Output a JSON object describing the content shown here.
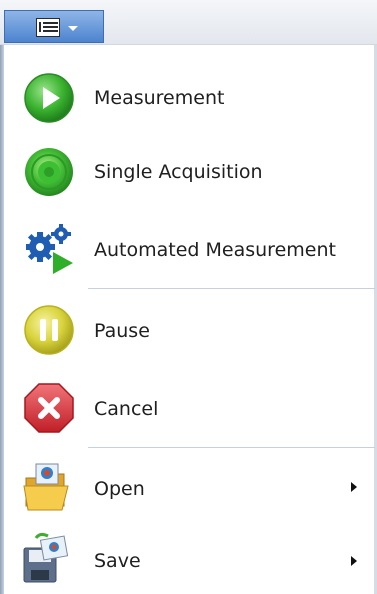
{
  "toolbar": {
    "menu_button_icon": "menu-list-icon",
    "dropdown_icon": "chevron-down-icon"
  },
  "menu": {
    "items": [
      {
        "label": "Measurement",
        "icon": "play-icon",
        "color": "#38b52f"
      },
      {
        "label": "Single Acquisition",
        "icon": "record-icon",
        "color": "#3fb93a"
      },
      {
        "label": "Automated Measurement",
        "icon": "gears-play-icon",
        "color": "#1e5fb4"
      },
      {
        "label": "Pause",
        "icon": "pause-icon",
        "color": "#d9d43a"
      },
      {
        "label": "Cancel",
        "icon": "cancel-icon",
        "color": "#d8353c"
      },
      {
        "label": "Open",
        "icon": "folder-open-icon",
        "has_submenu": true
      },
      {
        "label": "Save",
        "icon": "save-icon",
        "has_submenu": true
      }
    ]
  }
}
